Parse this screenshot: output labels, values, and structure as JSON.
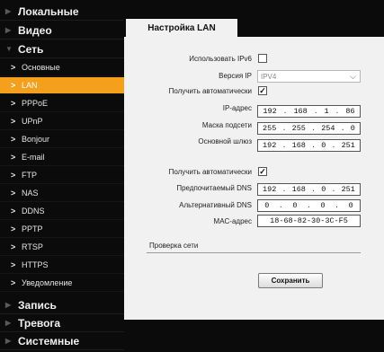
{
  "sidebar": {
    "cat_local": "Локальные",
    "cat_video": "Видео",
    "cat_network": "Сеть",
    "sub": {
      "basic": "Основные",
      "lan": "LAN",
      "pppoe": "PPPoE",
      "upnp": "UPnP",
      "bonjour": "Bonjour",
      "email": "E-mail",
      "ftp": "FTP",
      "nas": "NAS",
      "ddns": "DDNS",
      "pptp": "PPTP",
      "rtsp": "RTSP",
      "https": "HTTPS",
      "notify": "Уведомление"
    },
    "cat_record": "Запись",
    "cat_alarm": "Тревога",
    "cat_system": "Системные"
  },
  "tab": {
    "title": "Настройка LAN"
  },
  "form": {
    "ipv6_label": "Использовать IPv6",
    "ipv6_checked": "",
    "ipver_label": "Версия IP",
    "ipver_value": "IPV4",
    "auto_ip_label": "Получить автоматически",
    "auto_ip_checked": "✓",
    "ip_label": "IP-адрес",
    "ip": [
      "192",
      "168",
      "1",
      "86"
    ],
    "mask_label": "Маска подсети",
    "mask": [
      "255",
      "255",
      "254",
      "0"
    ],
    "gw_label": "Основной шлюз",
    "gw": [
      "192",
      "168",
      "0",
      "251"
    ],
    "auto_dns_label": "Получить автоматически",
    "auto_dns_checked": "✓",
    "dns1_label": "Предпочитаемый DNS",
    "dns1": [
      "192",
      "168",
      "0",
      "251"
    ],
    "dns2_label": "Альтернативный DNS",
    "dns2": [
      "0",
      "0",
      "0",
      "0"
    ],
    "mac_label": "MAC-адрес",
    "mac": "18-68-82-30-3C-F5",
    "net_check": "Проверка сети",
    "save": "Сохранить"
  },
  "icons": {
    "collapsed": "triangle-right-icon",
    "expanded": "triangle-down-icon",
    "item": "chevron-right-icon"
  },
  "colors": {
    "accent": "#f5a01c",
    "bg": "#0b0b0b",
    "panel": "#f1f1f1"
  }
}
